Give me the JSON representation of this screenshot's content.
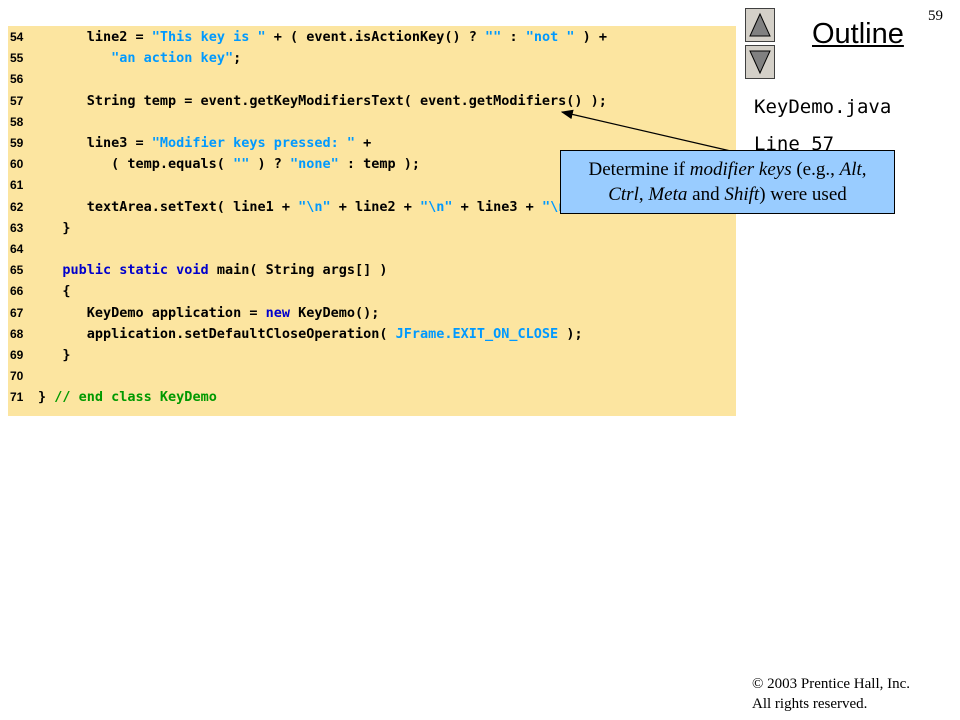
{
  "page_number": "59",
  "outline": {
    "title": "Outline",
    "up_button": "up-arrow-icon",
    "down_button": "down-arrow-icon"
  },
  "file_name": "KeyDemo.java",
  "line_ref": "Line 57",
  "callout": {
    "text_1": "Determine if ",
    "text_2": "modifier keys",
    "text_3": " (e.g., ",
    "text_4": "Alt",
    "text_5": ",",
    "text_6": "Ctrl",
    "text_7": ", ",
    "text_8": "Meta",
    "text_9": " and ",
    "text_10": "Shift",
    "text_11": ") were used"
  },
  "copyright": {
    "line1": "© 2003 Prentice Hall, Inc.",
    "line2": "All rights reserved."
  },
  "code_lines": [
    {
      "num": "54",
      "segs": [
        [
          "plain",
          "      line2 = "
        ],
        [
          "string",
          "\"This key is \""
        ],
        [
          "plain",
          " + ( event.isActionKey() ? "
        ],
        [
          "string",
          "\"\""
        ],
        [
          "plain",
          " : "
        ],
        [
          "string",
          "\"not \""
        ],
        [
          "plain",
          " ) +"
        ]
      ]
    },
    {
      "num": "55",
      "segs": [
        [
          "plain",
          "         "
        ],
        [
          "string",
          "\"an action key\""
        ],
        [
          "plain",
          ";"
        ]
      ]
    },
    {
      "num": "56",
      "segs": []
    },
    {
      "num": "57",
      "segs": [
        [
          "plain",
          "      String temp = event.getKeyModifiersText( event.getModifiers() );"
        ]
      ]
    },
    {
      "num": "58",
      "segs": []
    },
    {
      "num": "59",
      "segs": [
        [
          "plain",
          "      line3 = "
        ],
        [
          "string",
          "\"Modifier keys pressed: \""
        ],
        [
          "plain",
          " +"
        ]
      ]
    },
    {
      "num": "60",
      "segs": [
        [
          "plain",
          "         ( temp.equals( "
        ],
        [
          "string",
          "\"\""
        ],
        [
          "plain",
          " ) ? "
        ],
        [
          "string",
          "\"none\""
        ],
        [
          "plain",
          " : temp );"
        ]
      ]
    },
    {
      "num": "61",
      "segs": []
    },
    {
      "num": "62",
      "segs": [
        [
          "plain",
          "      textArea.setText( line1 + "
        ],
        [
          "string",
          "\"\\n\""
        ],
        [
          "plain",
          " + line2 + "
        ],
        [
          "string",
          "\"\\n\""
        ],
        [
          "plain",
          " + line3 + "
        ],
        [
          "string",
          "\"\\n\""
        ],
        [
          "plain",
          " );"
        ]
      ]
    },
    {
      "num": "63",
      "segs": [
        [
          "plain",
          "   }"
        ]
      ]
    },
    {
      "num": "64",
      "segs": []
    },
    {
      "num": "65",
      "segs": [
        [
          "plain",
          "   "
        ],
        [
          "keyword",
          "public static void"
        ],
        [
          "plain",
          " main( String args[] )"
        ]
      ]
    },
    {
      "num": "66",
      "segs": [
        [
          "plain",
          "   {"
        ]
      ]
    },
    {
      "num": "67",
      "segs": [
        [
          "plain",
          "      KeyDemo application = "
        ],
        [
          "keyword",
          "new"
        ],
        [
          "plain",
          " KeyDemo();"
        ]
      ]
    },
    {
      "num": "68",
      "segs": [
        [
          "plain",
          "      application.setDefaultCloseOperation( "
        ],
        [
          "string",
          "JFrame.EXIT_ON_CLOSE"
        ],
        [
          "plain",
          " );"
        ]
      ]
    },
    {
      "num": "69",
      "segs": [
        [
          "plain",
          "   }"
        ]
      ]
    },
    {
      "num": "70",
      "segs": []
    },
    {
      "num": "71",
      "segs": [
        [
          "plain",
          "}"
        ],
        [
          "comment",
          " // end class KeyDemo"
        ]
      ]
    }
  ],
  "colors": {
    "code_background": "#FCE5A0",
    "callout_background": "#99CCFF",
    "string": "#0099FF",
    "keyword": "#0000CC",
    "comment": "#009900"
  }
}
